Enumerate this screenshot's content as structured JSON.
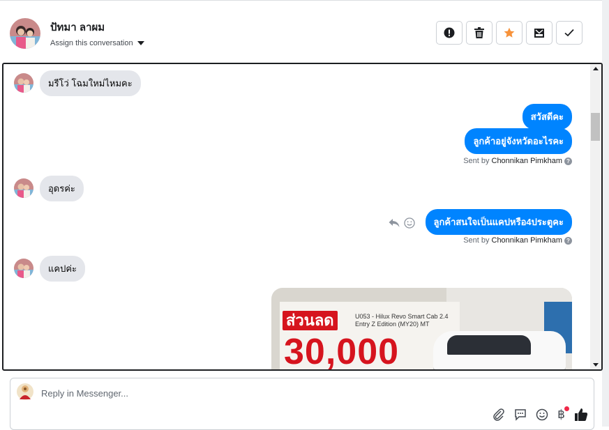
{
  "header": {
    "contact_name": "ปัทมา ลาผม",
    "assign_label": "Assign this conversation",
    "actions": [
      {
        "name": "mark-spam-button",
        "icon": "alert-icon"
      },
      {
        "name": "delete-button",
        "icon": "trash-icon"
      },
      {
        "name": "star-button",
        "icon": "star-icon"
      },
      {
        "name": "mark-unread-button",
        "icon": "envelope-icon"
      },
      {
        "name": "mark-done-button",
        "icon": "check-icon"
      }
    ]
  },
  "thread": {
    "messages": [
      {
        "from": "customer",
        "text": "มรีโว่ โฉมใหม่ไหมคะ"
      },
      {
        "from": "page",
        "text": "สวัสดีคะ"
      },
      {
        "from": "page",
        "text": "ลูกค้าอยู่จังหวัดอะไรคะ"
      },
      {
        "from": "customer",
        "text": "อุดรค่ะ"
      },
      {
        "from": "page",
        "text": "ลูกค้าสนใจเป็นแคปหรือ4ประตูคะ"
      },
      {
        "from": "customer",
        "text": "แคปค่ะ"
      }
    ],
    "sent_by_prefix": "Sent by",
    "sent_by_name": "Chonnikan Pimkham",
    "promo": {
      "sale_label": "ส่วนลด",
      "model_caption": "U053 - Hilux Revo Smart Cab 2.4 Entry Z Edition (MY20) MT",
      "amount": "30,000"
    }
  },
  "composer": {
    "placeholder": "Reply in Messenger..."
  },
  "colors": {
    "outgoing_bubble": "#0084ff",
    "incoming_bubble": "#e4e6eb",
    "star": "#f7923a",
    "sale_red": "#d6141e"
  }
}
